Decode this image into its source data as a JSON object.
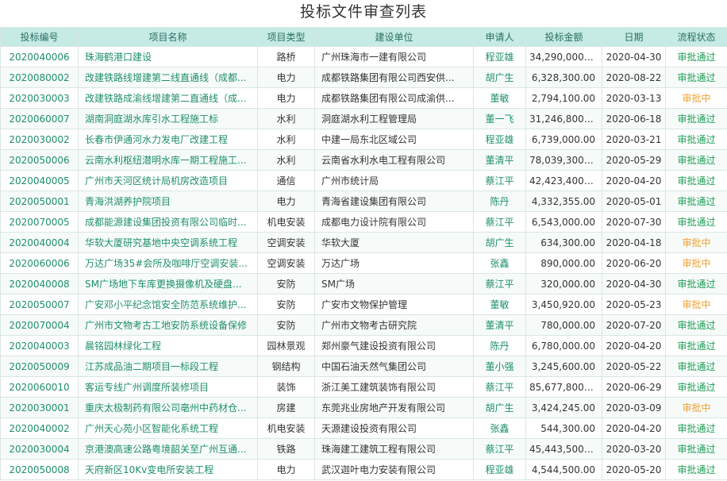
{
  "page_title": "投标文件审查列表",
  "colors": {
    "accent": "#1f8f6a",
    "header_bg": "#c6ebe4",
    "status_done": "#1f9d55",
    "status_pending": "#f0a030"
  },
  "columns": [
    "投标编号",
    "项目名称",
    "项目类型",
    "建设单位",
    "申请人",
    "投标金额",
    "日期",
    "流程状态"
  ],
  "rows": [
    {
      "id": "2020040006",
      "name": "珠海鹤港口建设",
      "type": "路桥",
      "unit": "广州珠海市一建有限公司",
      "applicant": "程亚雄",
      "amount": "34,290,000.00",
      "date": "2020-04-30",
      "status": "审批通过"
    },
    {
      "id": "2020080002",
      "name": "改建铁路线增建第二线直通线（成都...",
      "type": "电力",
      "unit": "成都铁路集团有限公司西安供...",
      "applicant": "胡广生",
      "amount": "6,328,300.00",
      "date": "2020-08-22",
      "status": "审批通过"
    },
    {
      "id": "2020030003",
      "name": "改建铁路成渝线增建第二直通线（成...",
      "type": "电力",
      "unit": "成都铁路集团有限公司成渝供...",
      "applicant": "董敏",
      "amount": "2,794,100.00",
      "date": "2020-03-13",
      "status": "审批中"
    },
    {
      "id": "2020060007",
      "name": "湖南洞庭湖水库引水工程施工标",
      "type": "水利",
      "unit": "洞庭湖水利工程管理局",
      "applicant": "董一飞",
      "amount": "31,246,800.00",
      "date": "2020-06-18",
      "status": "审批通过"
    },
    {
      "id": "2020030002",
      "name": "长春市伊通河水力发电厂改建工程",
      "type": "水利",
      "unit": "中建一局东北区域公司",
      "applicant": "程亚雄",
      "amount": "6,739,000.00",
      "date": "2020-03-21",
      "status": "审批通过"
    },
    {
      "id": "2020050006",
      "name": "云南水利枢纽潜明水库一期工程施工...",
      "type": "水利",
      "unit": "云南省水利水电工程有限公司",
      "applicant": "董清平",
      "amount": "78,039,300.00",
      "date": "2020-05-29",
      "status": "审批通过"
    },
    {
      "id": "2020040005",
      "name": "广州市天河区统计局机房改造项目",
      "type": "通信",
      "unit": "广州市统计局",
      "applicant": "蔡江平",
      "amount": "42,423,400.00",
      "date": "2020-04-20",
      "status": "审批通过"
    },
    {
      "id": "2020050001",
      "name": "青海洪湖养护院项目",
      "type": "电力",
      "unit": "青海省建设集团有限公司",
      "applicant": "陈丹",
      "amount": "4,332,355.00",
      "date": "2020-05-01",
      "status": "审批通过"
    },
    {
      "id": "2020070005",
      "name": "成都能源建设集团投资有限公司临时...",
      "type": "机电安装",
      "unit": "成都电力设计院有限公司",
      "applicant": "蔡江平",
      "amount": "6,543,000.00",
      "date": "2020-07-30",
      "status": "审批通过"
    },
    {
      "id": "2020040004",
      "name": "华软大厦研究基地中央空调系统工程",
      "type": "空调安装",
      "unit": "华软大厦",
      "applicant": "胡广生",
      "amount": "634,300.00",
      "date": "2020-04-18",
      "status": "审批中"
    },
    {
      "id": "2020060006",
      "name": "万达广场35#会所及咖啡厅空调安装...",
      "type": "空调安装",
      "unit": "万达广场",
      "applicant": "张鑫",
      "amount": "890,000.00",
      "date": "2020-06-20",
      "status": "审批中"
    },
    {
      "id": "2020040008",
      "name": "SM广场地下车库更换摄像机及硬盘...",
      "type": "安防",
      "unit": "SM广场",
      "applicant": "蔡江平",
      "amount": "320,000.00",
      "date": "2020-04-30",
      "status": "审批通过"
    },
    {
      "id": "2020050007",
      "name": "广安邓小平纪念馆安全防范系统维护...",
      "type": "安防",
      "unit": "广安市文物保护管理",
      "applicant": "董敏",
      "amount": "3,450,920.00",
      "date": "2020-05-23",
      "status": "审批中"
    },
    {
      "id": "2020070004",
      "name": "广州市文物考古工地安防系统设备保修",
      "type": "安防",
      "unit": "广州市文物考古研究院",
      "applicant": "董清平",
      "amount": "780,000.00",
      "date": "2020-07-20",
      "status": "审批通过"
    },
    {
      "id": "2020040003",
      "name": "晨铭园林绿化工程",
      "type": "园林景观",
      "unit": "郑州豪气建设投资有限公司",
      "applicant": "陈丹",
      "amount": "6,780,000.00",
      "date": "2020-04-20",
      "status": "审批通过"
    },
    {
      "id": "2020050009",
      "name": "江苏成品油二期项目一标段工程",
      "type": "钢结构",
      "unit": "中国石油天然气集团公司",
      "applicant": "董小强",
      "amount": "3,245,600.00",
      "date": "2020-05-22",
      "status": "审批通过"
    },
    {
      "id": "2020060010",
      "name": "客运专线广州调度所装修项目",
      "type": "装饰",
      "unit": "浙江美工建筑装饰有限公司",
      "applicant": "蔡江平",
      "amount": "85,677,800.00",
      "date": "2020-06-29",
      "status": "审批通过"
    },
    {
      "id": "2020030001",
      "name": "重庆太极制药有限公司亳州中药材仓...",
      "type": "房建",
      "unit": "东莞兆业房地产开发有限公司",
      "applicant": "胡广生",
      "amount": "3,424,245.00",
      "date": "2020-03-09",
      "status": "审批中"
    },
    {
      "id": "2020040002",
      "name": "广州天心苑小区智能化系统工程",
      "type": "机电安装",
      "unit": "天源建设投资有限公司",
      "applicant": "张鑫",
      "amount": "544,300.00",
      "date": "2020-04-20",
      "status": "审批通过"
    },
    {
      "id": "2020030004",
      "name": "京港澳高速公路粤境韶关至广州互通...",
      "type": "铁路",
      "unit": "珠海建工建筑工程有限公司",
      "applicant": "蔡江平",
      "amount": "45,443,500.00",
      "date": "2020-03-20",
      "status": "审批通过"
    },
    {
      "id": "2020050008",
      "name": "天府新区10Kv变电所安装工程",
      "type": "电力",
      "unit": "武汉迦叶电力安装有限公司",
      "applicant": "程亚雄",
      "amount": "4,544,500.00",
      "date": "2020-05-20",
      "status": "审批通过"
    }
  ]
}
